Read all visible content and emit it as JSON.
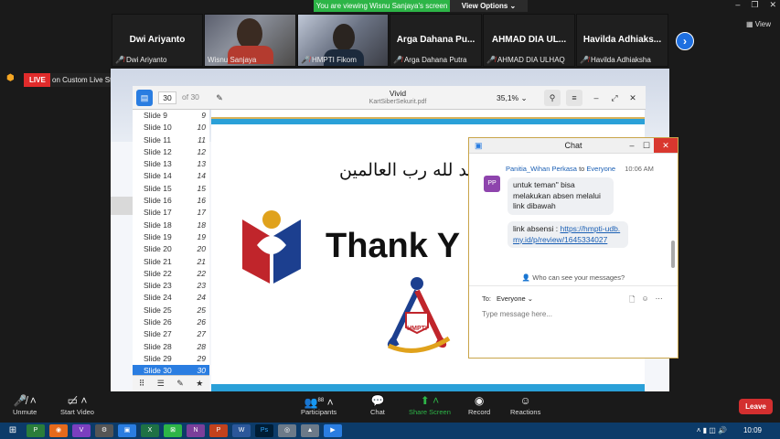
{
  "banner": {
    "viewing": "You are viewing Wisnu Sanjaya's screen",
    "view_options": "View Options ⌄"
  },
  "window_controls": {
    "minimize": "–",
    "restore": "❐",
    "close": "✕"
  },
  "view_label": "View",
  "participants": [
    {
      "name": "Dwi Ariyanto",
      "label": "Dwi Ariyanto"
    },
    {
      "name": "",
      "label": "Wisnu Sanjaya"
    },
    {
      "name": "",
      "label": "HMPTI Fikom"
    },
    {
      "name": "Arga Dahana Pu...",
      "label": "Arga Dahana Putra"
    },
    {
      "name": "AHMAD DIA UL...",
      "label": "AHMAD DIA ULHAQ"
    },
    {
      "name": "Havilda Adhiaks...",
      "label": "Havilda Adhiaksha"
    }
  ],
  "next_icon": "›",
  "live": {
    "badge": "LIVE",
    "service": "on Custom Live Streaming Service ⌄"
  },
  "pdf": {
    "page_current": "30",
    "page_total": "of 30",
    "app_name": "Vivid",
    "file_name": "KartSiberSekurit.pdf",
    "zoom": "35,1%",
    "slides": [
      {
        "label": "Slide 9",
        "num": "9"
      },
      {
        "label": "Slide 10",
        "num": "10"
      },
      {
        "label": "Slide 11",
        "num": "11"
      },
      {
        "label": "Slide 12",
        "num": "12"
      },
      {
        "label": "Slide 13",
        "num": "13"
      },
      {
        "label": "Slide 14",
        "num": "14"
      },
      {
        "label": "Slide 15",
        "num": "15"
      },
      {
        "label": "Slide 16",
        "num": "16"
      },
      {
        "label": "Slide 17",
        "num": "17"
      },
      {
        "label": "Slide 18",
        "num": "18"
      },
      {
        "label": "Slide 19",
        "num": "19"
      },
      {
        "label": "Slide 20",
        "num": "20"
      },
      {
        "label": "Slide 21",
        "num": "21"
      },
      {
        "label": "Slide 22",
        "num": "22"
      },
      {
        "label": "Slide 23",
        "num": "23"
      },
      {
        "label": "Slide 24",
        "num": "24"
      },
      {
        "label": "Slide 25",
        "num": "25"
      },
      {
        "label": "Slide 26",
        "num": "26"
      },
      {
        "label": "Slide 27",
        "num": "27"
      },
      {
        "label": "Slide 28",
        "num": "28"
      },
      {
        "label": "Slide 29",
        "num": "29"
      },
      {
        "label": "Slide 30",
        "num": "30"
      }
    ],
    "slide_arabic": "الحمد لله رب العالمين",
    "slide_heading": "Thank Y",
    "logo_text": "HMPTI"
  },
  "chat": {
    "title": "Chat",
    "sender": "Panitia_Wihan Perkasa",
    "to_word": "to",
    "recipient": "Everyone",
    "time": "10:06 AM",
    "avatar": "PP",
    "msg1": "untuk teman\" bisa melakukan absen melalui link dibawah",
    "msg2_prefix": "link absensi : ",
    "msg2_link": "https://hmpti-udb.my.id/p/review/1645334027",
    "who_can_see": "Who can see your messages?",
    "to_label": "To:",
    "to_value": "Everyone ⌄",
    "placeholder": "Type message here..."
  },
  "toolbar": {
    "unmute": "Unmute",
    "start_video": "Start Video",
    "participants": "Participants",
    "participants_count": "88",
    "chat": "Chat",
    "share_screen": "Share Screen",
    "record": "Record",
    "reactions": "Reactions",
    "leave": "Leave"
  },
  "taskbar": {
    "clock": "10:09"
  },
  "colors": {
    "accent": "#2db547",
    "live": "#e02b2b",
    "leave": "#d32f2f",
    "pdf_selected": "#2a7de1",
    "taskbar": "#0c3b69"
  }
}
